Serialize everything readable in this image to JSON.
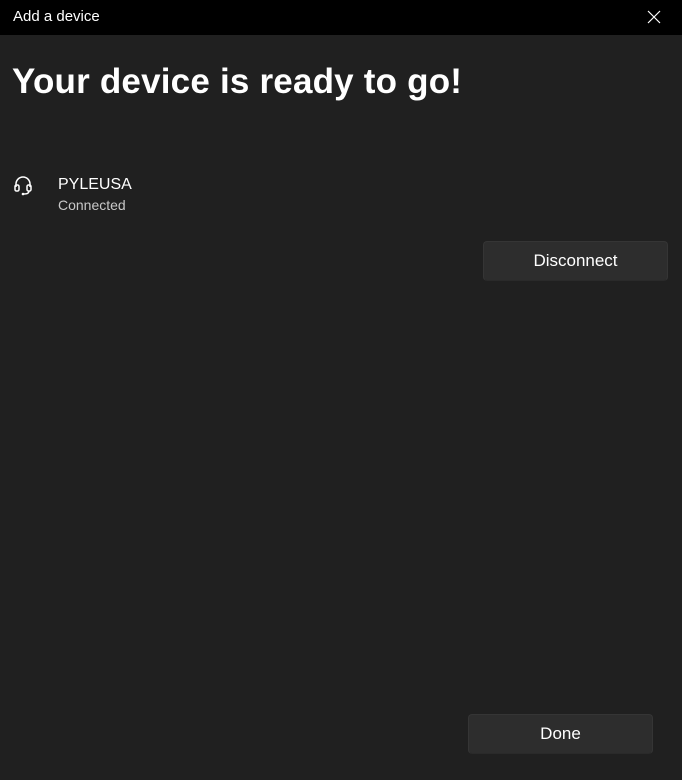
{
  "window": {
    "title": "Add a device",
    "close_icon": "close-icon"
  },
  "main": {
    "heading": "Your device is ready to go!"
  },
  "device": {
    "icon": "headset-icon",
    "name": "PYLEUSA",
    "status": "Connected"
  },
  "actions": {
    "disconnect_label": "Disconnect",
    "done_label": "Done"
  },
  "colors": {
    "background": "#202020",
    "titlebar": "#000000",
    "button": "#2d2d2d",
    "status_text": "#c8c8c8"
  }
}
